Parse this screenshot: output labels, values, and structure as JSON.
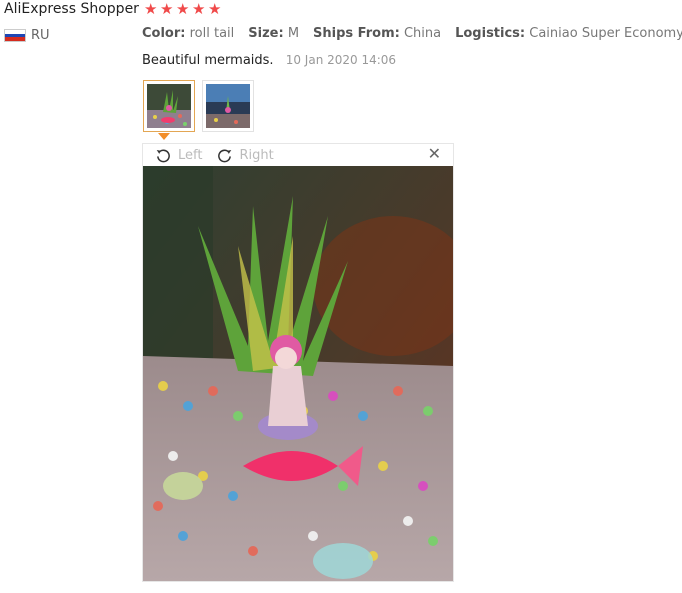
{
  "review": {
    "reviewer": "AliExpress Shopper",
    "rating": 5,
    "country": "RU",
    "flag_colors": [
      "#ffffff",
      "#1e46b4",
      "#d52b1e"
    ],
    "attributes": [
      {
        "key": "Color:",
        "value": "roll tail"
      },
      {
        "key": "Size:",
        "value": "M"
      },
      {
        "key": "Ships From:",
        "value": "China"
      },
      {
        "key": "Logistics:",
        "value": "Cainiao Super Economy"
      }
    ],
    "text": "Beautiful mermaids.",
    "date": "10 Jan 2020 14:06",
    "thumbnails": [
      {
        "name": "photo-1",
        "selected": true
      },
      {
        "name": "photo-2",
        "selected": false
      }
    ]
  },
  "viewer": {
    "rotate_left_label": "Left",
    "rotate_right_label": "Right",
    "close_icon": "close-icon"
  },
  "colors": {
    "star": "#f04a4a",
    "active_thumb_border": "#e3a653",
    "caret": "#f28e29"
  }
}
